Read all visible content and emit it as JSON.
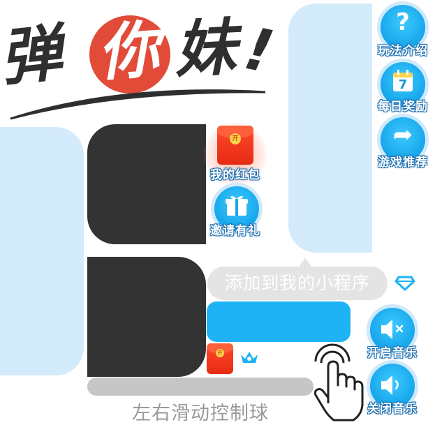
{
  "logo": {
    "char1": "弹",
    "char2": "你",
    "char3": "妹",
    "excl": "!"
  },
  "side_menu": [
    {
      "label": "玩法介绍",
      "icon": "question-icon",
      "glyph": "?"
    },
    {
      "label": "每日奖励",
      "icon": "calendar-icon",
      "glyph": "7"
    },
    {
      "label": "游戏推荐",
      "icon": "share-arrow-icon",
      "glyph": "➦"
    }
  ],
  "middle_menu": [
    {
      "label": "我的红包",
      "icon": "red-envelope-icon"
    },
    {
      "label": "邀请有礼",
      "icon": "gift-icon"
    }
  ],
  "envelope_seal": "开",
  "add_prompt": "添加到我的小程序",
  "sound": [
    {
      "label": "开启音乐",
      "icon": "speaker-mute-icon"
    },
    {
      "label": "关闭音乐",
      "icon": "speaker-icon"
    }
  ],
  "hint": "左右滑动控制球",
  "colors": {
    "accent_blue": "#1fb2f5",
    "panel_blue": "#d4ebfb",
    "dark_block": "#333333",
    "logo_red": "#e24b38"
  }
}
